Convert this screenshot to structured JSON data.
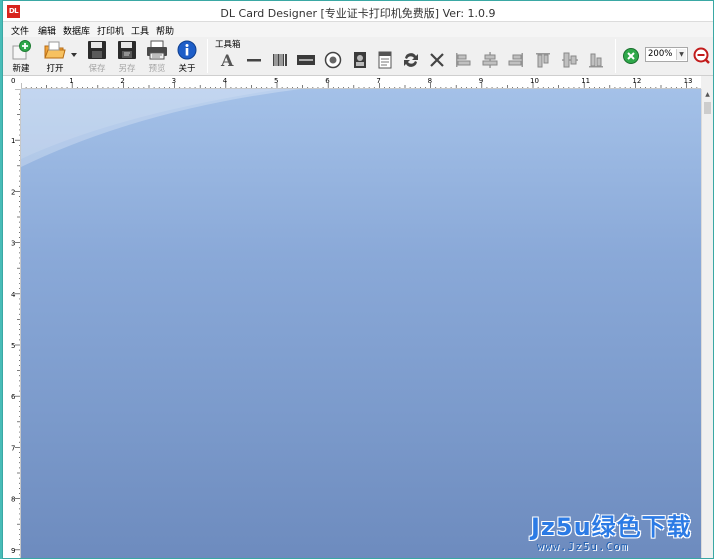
{
  "window": {
    "icon_text": "DL",
    "title": "DL Card Designer [专业证卡打印机免费版] Ver: 1.0.9"
  },
  "menu": [
    "文件",
    "编辑",
    "数据库",
    "打印机",
    "工具",
    "帮助"
  ],
  "toolbar": {
    "new_label": "新建",
    "open_label": "打开",
    "save_label": "保存",
    "save_as_label": "另存",
    "preview_label": "预览",
    "about_label": "关于",
    "toolbox_label": "工具箱",
    "zoom_value": "200%"
  },
  "icons": {
    "new": "new-file-icon",
    "open": "open-folder-icon",
    "save": "floppy-disk-icon",
    "save_as": "floppy-disk-icon",
    "preview": "printer-preview-icon",
    "about": "info-icon"
  },
  "ruler": {
    "horizontal": [
      "1",
      "2",
      "3",
      "4",
      "5",
      "6",
      "7",
      "8",
      "9",
      "10",
      "11",
      "12",
      "13"
    ],
    "vertical": [
      "1",
      "2",
      "3",
      "4",
      "5",
      "6",
      "7",
      "8",
      "9"
    ],
    "origin": "0"
  },
  "colors": {
    "canvas_top": "#a4c1e8",
    "canvas_bottom": "#6d8bbe",
    "accent": "#2c7be5"
  },
  "watermark": {
    "text": "Jz5u绿色下载",
    "url": "www.Jz5u.Com"
  }
}
